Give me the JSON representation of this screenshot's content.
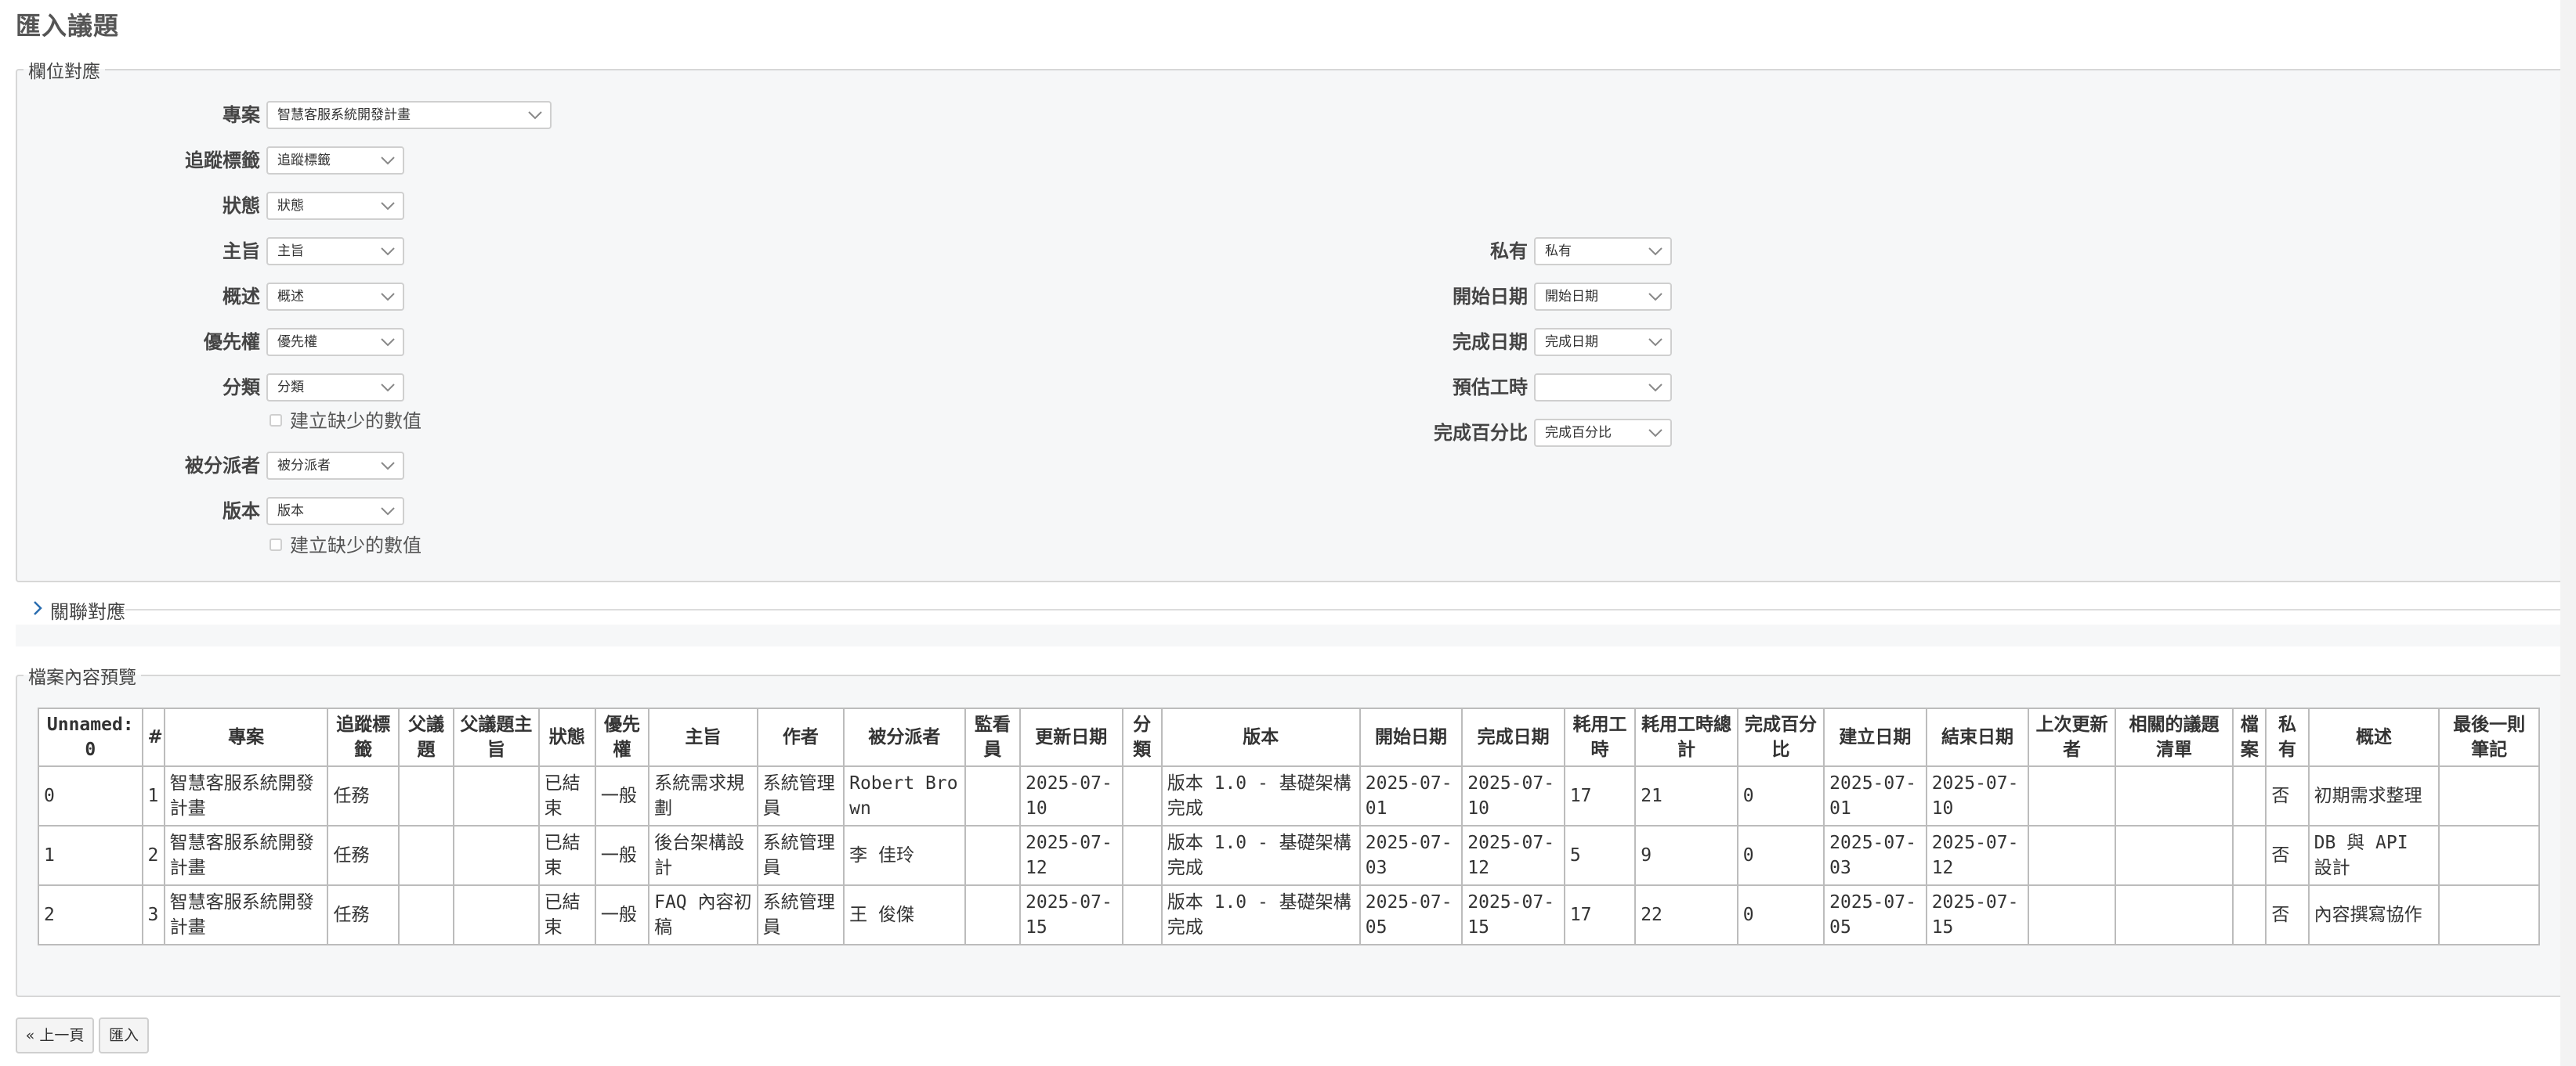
{
  "page": {
    "title": "匯入議題"
  },
  "mapping": {
    "legend": "欄位對應",
    "left_fields": [
      {
        "label": "專案",
        "value": "智慧客服系統開發計畫"
      },
      {
        "label": "追蹤標籤",
        "value": "追蹤標籤"
      },
      {
        "label": "狀態",
        "value": "狀態"
      },
      {
        "label": "主旨",
        "value": "主旨"
      },
      {
        "label": "概述",
        "value": "概述"
      },
      {
        "label": "優先權",
        "value": "優先權"
      },
      {
        "label": "分類",
        "value": "分類"
      },
      {
        "label": "被分派者",
        "value": "被分派者"
      },
      {
        "label": "版本",
        "value": "版本"
      }
    ],
    "right_fields": [
      {
        "label": "私有",
        "value": "私有"
      },
      {
        "label": "開始日期",
        "value": "開始日期"
      },
      {
        "label": "完成日期",
        "value": "完成日期"
      },
      {
        "label": "預估工時",
        "value": ""
      },
      {
        "label": "完成百分比",
        "value": "完成百分比"
      }
    ],
    "create_missing_label": "建立缺少的數值"
  },
  "relations": {
    "label": "關聯對應"
  },
  "preview": {
    "legend": "檔案內容預覽",
    "columns": [
      "Unnamed: 0",
      "#",
      "專案",
      "追蹤標籤",
      "父議題",
      "父議題主旨",
      "狀態",
      "優先權",
      "主旨",
      "作者",
      "被分派者",
      "監看員",
      "更新日期",
      "分類",
      "版本",
      "開始日期",
      "完成日期",
      "耗用工時",
      "耗用工時總計",
      "完成百分比",
      "建立日期",
      "結束日期",
      "上次更新者",
      "相關的議題清單",
      "檔案",
      "私有",
      "概述",
      "最後一則筆記"
    ],
    "rows": [
      [
        "0",
        "1",
        "智慧客服系統開發計畫",
        "任務",
        "",
        "",
        "已結束",
        "一般",
        "系統需求規劃",
        "系統管理員",
        "Robert Brown",
        "",
        "2025-07-10",
        "",
        "版本 1.0 - 基礎架構完成",
        "2025-07-01",
        "2025-07-10",
        "17",
        "21",
        "0",
        "2025-07-01",
        "2025-07-10",
        "",
        "",
        "",
        "否",
        "初期需求整理",
        ""
      ],
      [
        "1",
        "2",
        "智慧客服系統開發計畫",
        "任務",
        "",
        "",
        "已結束",
        "一般",
        "後台架構設計",
        "系統管理員",
        "李 佳玲",
        "",
        "2025-07-12",
        "",
        "版本 1.0 - 基礎架構完成",
        "2025-07-03",
        "2025-07-12",
        "5",
        "9",
        "0",
        "2025-07-03",
        "2025-07-12",
        "",
        "",
        "",
        "否",
        "DB 與 API 設計",
        ""
      ],
      [
        "2",
        "3",
        "智慧客服系統開發計畫",
        "任務",
        "",
        "",
        "已結束",
        "一般",
        "FAQ 內容初稿",
        "系統管理員",
        "王 俊傑",
        "",
        "2025-07-15",
        "",
        "版本 1.0 - 基礎架構完成",
        "2025-07-05",
        "2025-07-15",
        "17",
        "22",
        "0",
        "2025-07-05",
        "2025-07-15",
        "",
        "",
        "",
        "否",
        "內容撰寫協作",
        ""
      ]
    ]
  },
  "buttons": {
    "previous": "« 上一頁",
    "import": "匯入"
  }
}
